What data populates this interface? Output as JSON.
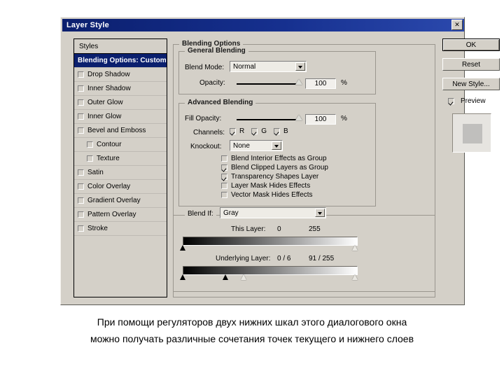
{
  "window": {
    "title": "Layer Style",
    "close_icon": "close-icon"
  },
  "styles_panel": {
    "header": "Styles",
    "items": [
      {
        "label": "Blending Options: Custom",
        "selected": true,
        "checkbox": false,
        "indent": false
      },
      {
        "label": "Drop Shadow",
        "selected": false,
        "checkbox": true,
        "checked": false,
        "indent": false
      },
      {
        "label": "Inner Shadow",
        "selected": false,
        "checkbox": true,
        "checked": false,
        "indent": false
      },
      {
        "label": "Outer Glow",
        "selected": false,
        "checkbox": true,
        "checked": false,
        "indent": false
      },
      {
        "label": "Inner Glow",
        "selected": false,
        "checkbox": true,
        "checked": false,
        "indent": false
      },
      {
        "label": "Bevel and Emboss",
        "selected": false,
        "checkbox": true,
        "checked": false,
        "indent": false
      },
      {
        "label": "Contour",
        "selected": false,
        "checkbox": true,
        "checked": false,
        "indent": true
      },
      {
        "label": "Texture",
        "selected": false,
        "checkbox": true,
        "checked": false,
        "indent": true
      },
      {
        "label": "Satin",
        "selected": false,
        "checkbox": true,
        "checked": false,
        "indent": false
      },
      {
        "label": "Color Overlay",
        "selected": false,
        "checkbox": true,
        "checked": false,
        "indent": false
      },
      {
        "label": "Gradient Overlay",
        "selected": false,
        "checkbox": true,
        "checked": false,
        "indent": false
      },
      {
        "label": "Pattern Overlay",
        "selected": false,
        "checkbox": true,
        "checked": false,
        "indent": false
      },
      {
        "label": "Stroke",
        "selected": false,
        "checkbox": true,
        "checked": false,
        "indent": false
      }
    ]
  },
  "blending_options": {
    "group_title": "Blending Options",
    "general": {
      "group_title": "General Blending",
      "blend_mode_label": "Blend Mode:",
      "blend_mode_value": "Normal",
      "opacity_label": "Opacity:",
      "opacity_value": "100",
      "opacity_unit": "%"
    },
    "advanced": {
      "group_title": "Advanced Blending",
      "fill_opacity_label": "Fill Opacity:",
      "fill_opacity_value": "100",
      "fill_opacity_unit": "%",
      "channels_label": "Channels:",
      "channels": [
        {
          "label": "R",
          "checked": true
        },
        {
          "label": "G",
          "checked": true
        },
        {
          "label": "B",
          "checked": true
        }
      ],
      "knockout_label": "Knockout:",
      "knockout_value": "None",
      "options": [
        {
          "label": "Blend Interior Effects as Group",
          "checked": false
        },
        {
          "label": "Blend Clipped Layers as Group",
          "checked": true
        },
        {
          "label": "Transparency Shapes Layer",
          "checked": true
        },
        {
          "label": "Layer Mask Hides Effects",
          "checked": false
        },
        {
          "label": "Vector Mask Hides Effects",
          "checked": false
        }
      ]
    },
    "blend_if": {
      "label": "Blend If:",
      "value": "Gray",
      "this_layer": {
        "label": "This Layer:",
        "low": "0",
        "high": "255"
      },
      "underlying_layer": {
        "label": "Underlying Layer:",
        "low": "0 / 6",
        "high": "91 / 255"
      }
    }
  },
  "buttons": {
    "ok": "OK",
    "reset": "Reset",
    "new_style": "New Style...",
    "preview_label": "Preview",
    "preview_checked": true
  },
  "caption": {
    "line1": "При помощи регуляторов двух нижних шкал этого диалогового окна",
    "line2": "можно получать различные сочетания точек текущего и нижнего слоев"
  },
  "colors": {
    "dialog_face": "#d4d0c8",
    "titlebar": "#16308f",
    "selection": "#0a1f6e",
    "text": "#000000"
  }
}
